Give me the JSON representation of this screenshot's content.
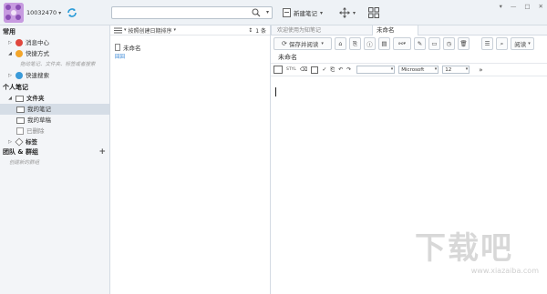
{
  "topbar": {
    "account": "10032470",
    "search_placeholder": "",
    "new_note_label": "新建笔记",
    "window_controls": [
      "▾",
      "—",
      "□",
      "✕"
    ]
  },
  "sidebar": {
    "section_common": "常用",
    "message_center": "消息中心",
    "shortcuts": "快捷方式",
    "shortcuts_hint": "拖动笔记、文件夹、标签或者搜索",
    "quick_search": "快速搜索",
    "section_personal": "个人笔记",
    "folder": "文件夹",
    "my_notes": "我的笔记",
    "my_drafts": "我的草稿",
    "deleted": "已删除",
    "tags": "标签",
    "section_team": "团队 & 群组",
    "team_hint": "创建新的群组"
  },
  "notelist": {
    "sort_label": "按照创建日期排序",
    "count": "1 条",
    "note_title": "未命名",
    "note_sub": "回回"
  },
  "editor": {
    "tab_welcome": "欢迎使用为知笔记",
    "tab_untitled": "未命名",
    "save_read_label": "保存并阅读",
    "read_label": "阅读",
    "title": "未命名",
    "font_name": "Microsoft",
    "font_size": "12",
    "style_btn": "STYL",
    "more": "»"
  },
  "watermark": {
    "brand": "下载吧",
    "url": "www.xiazaiba.com"
  }
}
